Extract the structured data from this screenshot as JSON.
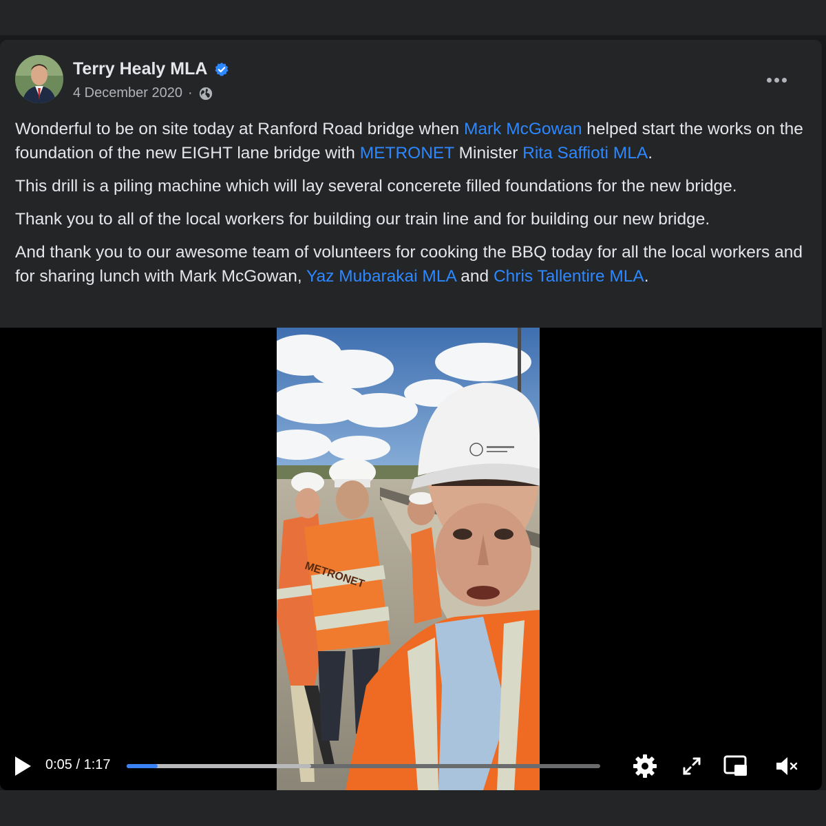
{
  "post": {
    "author": "Terry Healy MLA",
    "date": "4 December 2020",
    "separator": "·",
    "paragraphs": [
      {
        "segments": [
          {
            "text": "Wonderful to be on site today at Ranford Road bridge when "
          },
          {
            "text": "Mark McGowan",
            "link": true
          },
          {
            "text": " helped start the works on the foundation of the new EIGHT lane bridge with "
          },
          {
            "text": "METRONET",
            "link": true
          },
          {
            "text": " Minister "
          },
          {
            "text": "Rita Saffioti MLA",
            "link": true
          },
          {
            "text": "."
          }
        ]
      },
      {
        "segments": [
          {
            "text": "This drill is a piling machine which will lay several concerete filled foundations for the new bridge."
          }
        ]
      },
      {
        "segments": [
          {
            "text": "Thank you to all of the local workers for building our train line and for building our new bridge."
          }
        ]
      },
      {
        "segments": [
          {
            "text": "And thank you to our awesome team of volunteers for cooking the BBQ today for all the local workers and for sharing lunch with Mark McGowan, "
          },
          {
            "text": "Yaz Mubarakai MLA",
            "link": true
          },
          {
            "text": " and "
          },
          {
            "text": "Chris Tallentire MLA",
            "link": true
          },
          {
            "text": "."
          }
        ]
      }
    ]
  },
  "video": {
    "time_display": "0:05 / 1:17",
    "played_fraction": 0.065,
    "buffered_fraction": 0.39,
    "vest_text": "METRONET"
  },
  "icons": {
    "verified": "verified-badge-icon",
    "audience": "globe-icon",
    "more": "more-options-icon",
    "play": "play-icon",
    "settings": "gear-icon",
    "fullscreen": "expand-icon",
    "pip": "picture-in-picture-icon",
    "mute": "volume-muted-icon"
  },
  "colors": {
    "link": "#2d88ff",
    "progress": "#3b82f6",
    "verified": "#2d88ff"
  }
}
